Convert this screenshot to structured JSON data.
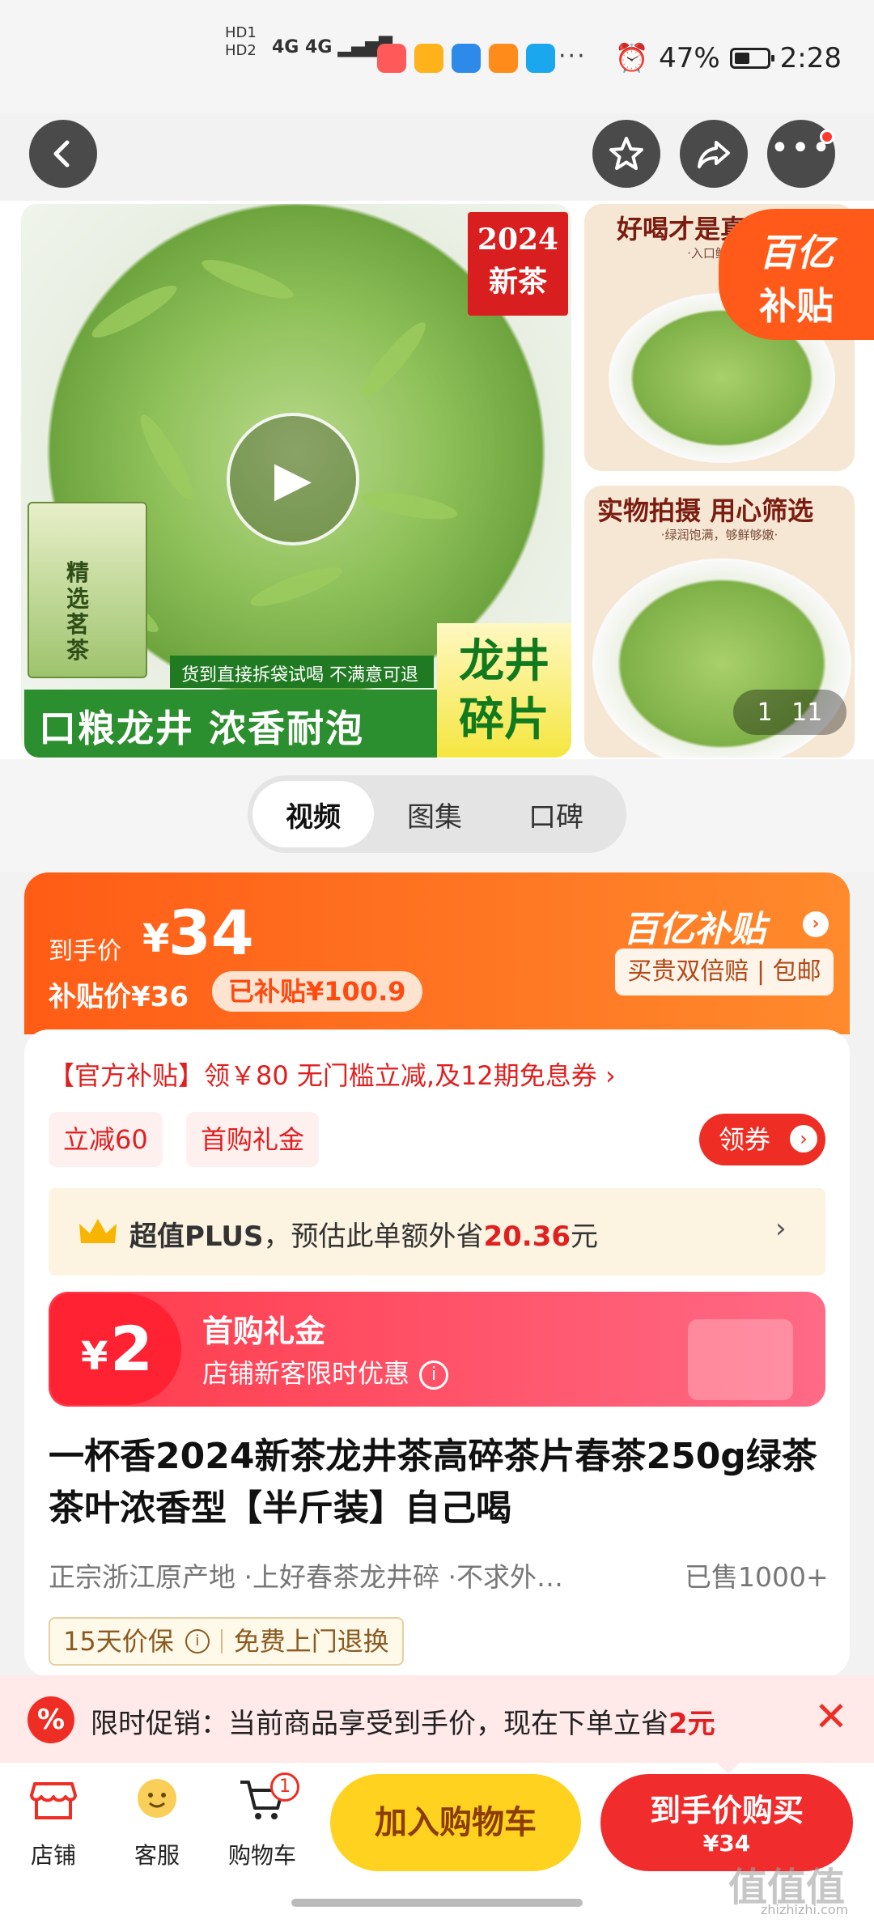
{
  "status_bar": {
    "network": "4G 4G",
    "hd_labels": [
      "HD1",
      "HD2"
    ],
    "dots": "···",
    "battery": "47%",
    "time": "2:28"
  },
  "gallery": {
    "badge_year": "2024",
    "badge_new": "新茶",
    "banner_main": "口粮龙井 浓香耐泡",
    "banner_sub": "货到直接拆袋试喝 不满意可退",
    "banner_side": "龙井碎片",
    "pack_text": "精选茗茶",
    "thumb1_caption": "好喝才是真道理",
    "thumb1_sub": "·入口鲜浓，",
    "thumb2_caption": "实物拍摄 用心筛选",
    "thumb2_sub": "·绿润饱满，够鲜够嫩·",
    "yi_line1": "百亿",
    "yi_line2": "补贴",
    "counter_current": "1",
    "counter_total": "11"
  },
  "tabs": [
    {
      "label": "视频",
      "active": true
    },
    {
      "label": "图集",
      "active": false
    },
    {
      "label": "口碑",
      "active": false
    }
  ],
  "price": {
    "label": "到手价",
    "currency": "¥",
    "amount": "34",
    "subsidy_price": "补贴价¥36",
    "subsidized": "已补贴¥100.9",
    "brand": "百亿补贴",
    "brand_tag": "买贵双倍赔 | 包邮"
  },
  "coupon": {
    "line": "【官方补贴】领￥80 无门槛立减,及12期免息券 ›",
    "chips": [
      "立减60",
      "首购礼金"
    ],
    "get_label": "领券"
  },
  "plus": {
    "prefix": "超值PLUS",
    "text": "，预估此单额外省",
    "amount": "20.36",
    "suffix": "元",
    "chevron": "›"
  },
  "gift": {
    "currency": "¥",
    "amount": "2",
    "title": "首购礼金",
    "subtitle": "店铺新客限时优惠"
  },
  "product": {
    "title": "一杯香2024新茶龙井茶高碎茶片春茶250g绿茶茶叶浓香型【半斤装】自己喝",
    "features": "正宗浙江原产地 ·上好春茶龙井碎 ·不求外…",
    "sold": "已售1000+",
    "guarantee1": "15天价保",
    "guarantee2": "免费上门退换"
  },
  "promo": {
    "icon": "%",
    "text": "限时促销：当前商品享受到手价，现在下单立省",
    "amount": "2",
    "suffix": "元",
    "close": "✕"
  },
  "bottom_nav": {
    "shop": "店铺",
    "service": "客服",
    "cart": "购物车",
    "cart_count": "1",
    "add_cart": "加入购物车",
    "buy_line1": "到手价购买",
    "buy_line2": "¥34"
  },
  "watermark": {
    "main": "值值值",
    "sub": "zhizhizhi.com"
  },
  "colors": {
    "accent_orange": "#ff5c16",
    "accent_red": "#ee2e24",
    "cart_yellow": "#ffd21f"
  }
}
